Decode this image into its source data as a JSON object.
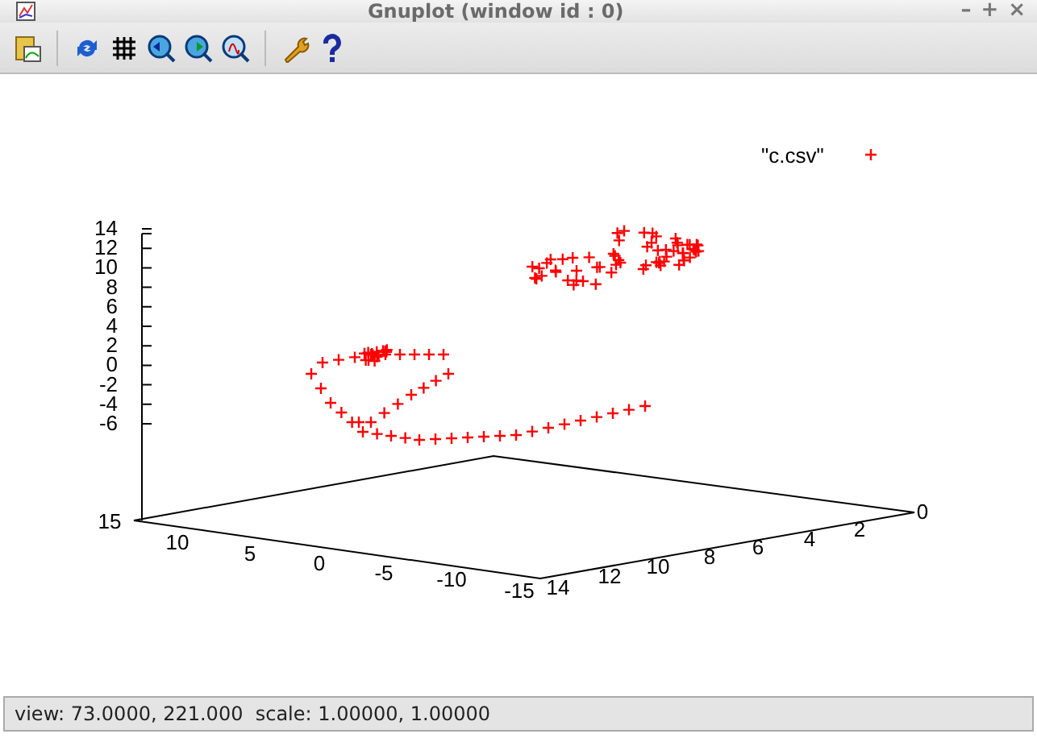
{
  "window": {
    "title": "Gnuplot (window id : 0)",
    "controls": [
      "–",
      "+",
      "×"
    ]
  },
  "plot": {
    "legend": "\"c.csv\"",
    "z_ticks": [
      "14",
      "12",
      "10",
      "8",
      "6",
      "4",
      "2",
      "0",
      "-2",
      "-4",
      "-6"
    ],
    "x_ticks": [
      "15",
      "10",
      "5",
      "0",
      "-5",
      "-10",
      "-15"
    ],
    "y_ticks": [
      "14",
      "12",
      "10",
      "8",
      "6",
      "4",
      "2",
      "0"
    ]
  },
  "status_bar": {
    "text": "view: 73.0000, 221.000  scale: 1.00000, 1.00000"
  }
}
